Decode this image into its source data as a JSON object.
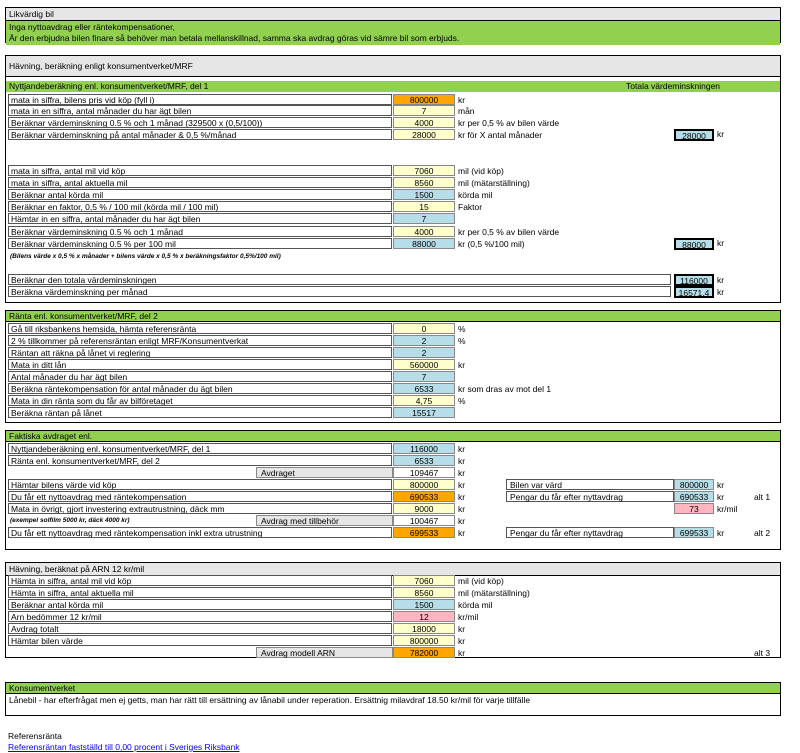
{
  "top": {
    "title": "Likvärdig bil",
    "line1": "Inga nyttoavdrag eller räntekompensationer,",
    "line2": "Är den erbjudna bilen finare så behöver man betala mellanskillnad, samma ska avdrag göras vid sämre bil som erbjuds."
  },
  "s1": {
    "title": "Hävning, beräkning enligt konsumentverket/MRF",
    "part1_title": "Nyttjandeberäkning enl. konsumentverket/MRF, del 1",
    "total_title": "Totala värdeminskningen",
    "rowsA": [
      {
        "label": "mata in siffra, bilens pris vid köp (fyll i)",
        "value": "800000",
        "unit": "kr",
        "color": "o"
      },
      {
        "label": "mata in en siffra, antal månader du har ägt bilen",
        "value": "7",
        "unit": "mån",
        "color": "y"
      },
      {
        "label": "Beräknar värdeminskning 0.5 % och 1 månad (329500 x (0,5/100))",
        "value": "4000",
        "unit": "kr per 0,5 % av bilen värde",
        "color": "y"
      },
      {
        "label": "Beräknar värdeminskning på antal månader & 0,5 %/månad",
        "value": "28000",
        "unit": "kr för X antal månader",
        "color": "y"
      }
    ],
    "totA": "28000",
    "rowsB": [
      {
        "label": "mata in siffra, antal mil vid köp",
        "value": "7060",
        "unit": "mil (vid köp)",
        "color": "y"
      },
      {
        "label": "mata in siffra, antal aktuella mil",
        "value": "8560",
        "unit": "mil (mätarställning)",
        "color": "y"
      },
      {
        "label": "Beräknar antal körda mil",
        "value": "1500",
        "unit": "körda mil",
        "color": "b"
      },
      {
        "label": "Beräknar en faktor, 0,5 % / 100 mil (körda mil / 100 mil)",
        "value": "15",
        "unit": "Faktor",
        "color": "y"
      },
      {
        "label": "Hämtar in en siffra, antal månader du har ägt bilen",
        "value": "7",
        "unit": "",
        "color": "b"
      },
      {
        "label": "Beräknar värdeminskning 0.5 % och 1 månad",
        "value": "4000",
        "unit": "kr per 0,5 % av bilen värde",
        "color": "y"
      },
      {
        "label": "Beräknar värdeminskning 0.5 % per 100 mil",
        "value": "88000",
        "unit": "kr (0,5 %/100 mil)",
        "color": "b"
      }
    ],
    "totB": "88000",
    "note": "(Bilens värde x 0,5 % x månader + bilens värde x 0,5 % x beräkningsfaktor 0,5%/100 mil)",
    "rowsC": [
      {
        "label": "Beräknar den totala värdeminskningen",
        "value": "116000",
        "unit": "kr"
      },
      {
        "label": "Beräkna värdeminskning per månad",
        "value": "16571,4",
        "unit": "kr"
      }
    ]
  },
  "s2": {
    "title": "Ränta enl. konsumentverket/MRF, del 2",
    "rows": [
      {
        "label": "Gå till riksbankens hemsida, hämta referensränta",
        "value": "0",
        "unit": "%",
        "color": "y"
      },
      {
        "label": "2 % tillkommer på referensräntan enligt MRF/Konsumentverkat",
        "value": "2",
        "unit": "%",
        "color": "b"
      },
      {
        "label": "Räntan att räkna på lånet vi reglering",
        "value": "2",
        "unit": "",
        "color": "b"
      },
      {
        "label": "Mata in ditt lån",
        "value": "560000",
        "unit": "kr",
        "color": "y"
      },
      {
        "label": "Antal månader du har ägt bilen",
        "value": "7",
        "unit": "",
        "color": "b"
      },
      {
        "label": "Beräkna räntekompensation för antal månader du ägt bilen",
        "value": "6533",
        "unit": "kr som dras av mot del 1",
        "color": "b"
      },
      {
        "label": "Mata in din ränta som du får av bilföretaget",
        "value": "4,75",
        "unit": "%",
        "color": "y"
      },
      {
        "label": "Beräkna räntan på lånet",
        "value": "15517",
        "unit": "",
        "color": "b"
      }
    ]
  },
  "s3": {
    "title": "Faktiska avdraget enl.",
    "r1": {
      "label": "Nyttjandeberäkning enl. konsumentverket/MRF, del 1",
      "value": "116000",
      "unit": "kr"
    },
    "r2": {
      "label": "Ränta enl. konsumentverket/MRF, del 2",
      "value": "6533",
      "unit": "kr"
    },
    "r3": {
      "label": "Avdraget",
      "value": "109467",
      "unit": "kr"
    },
    "r4": {
      "label": "Hämtar bilens värde vid köp",
      "value": "800000",
      "unit": "kr"
    },
    "r5": {
      "label": "Du får ett nyttoavdrag med räntekompensation",
      "value": "690533",
      "unit": "kr"
    },
    "r6": {
      "label": "Mata in övrigt, gjort investering extrautrustning, däck mm",
      "value": "9000",
      "unit": "kr"
    },
    "r7note": "(exempel solfilm 5000 kr, däck 4000 kr)",
    "r7": {
      "label": "Avdrag med tillbehör",
      "value": "100467",
      "unit": "kr"
    },
    "r8": {
      "label": "Du får ett nyttoavdrag med räntekompensation inkl extra utrustning",
      "value": "699533",
      "unit": "kr"
    },
    "right1": {
      "label": "Bilen var värd",
      "value": "800000",
      "unit": "kr"
    },
    "right2": {
      "label": "Pengar du får efter nyttavdrag",
      "value": "690533",
      "unit": "kr",
      "alt": "alt 1"
    },
    "right3": {
      "value": "73",
      "unit": "kr/mil"
    },
    "right4": {
      "label": "Pengar du får efter nyttavdrag",
      "value": "699533",
      "unit": "kr",
      "alt": "alt 2"
    }
  },
  "s4": {
    "title": "Hävning, beräknat på ARN 12 kr/mil",
    "rows": [
      {
        "label": "Hämta in siffra, antal mil vid köp",
        "value": "7060",
        "unit": "mil (vid köp)",
        "color": "y"
      },
      {
        "label": "Hämta in siffra, antal aktuella mil",
        "value": "8560",
        "unit": "mil (mätarställning)",
        "color": "y"
      },
      {
        "label": "Beräknar antal körda mil",
        "value": "1500",
        "unit": "körda mil",
        "color": "b"
      },
      {
        "label": "Arn bedömmer 12 kr/mil",
        "value": "12",
        "unit": "kr/mil",
        "color": "p"
      },
      {
        "label": "Avdrag totalt",
        "value": "18000",
        "unit": "kr",
        "color": "y"
      },
      {
        "label": "Hämtar bilen värde",
        "value": "800000",
        "unit": "kr",
        "color": "y"
      }
    ],
    "last": {
      "label": "Avdrag modell ARN",
      "value": "782000",
      "unit": "kr",
      "alt": "alt 3"
    }
  },
  "s5": {
    "title": "Konsumentverket",
    "text": "Lånebil - har efterfrågat men ej getts, man har rätt till ersättning av lånabil under reperation. Ersättnig milavdraf 18.50 kr/mil för varje tillfälle"
  },
  "footer": {
    "title": "Referensränta",
    "link": "Referensräntan fastställd till 0,00 procent i Sveriges Riksbank"
  }
}
